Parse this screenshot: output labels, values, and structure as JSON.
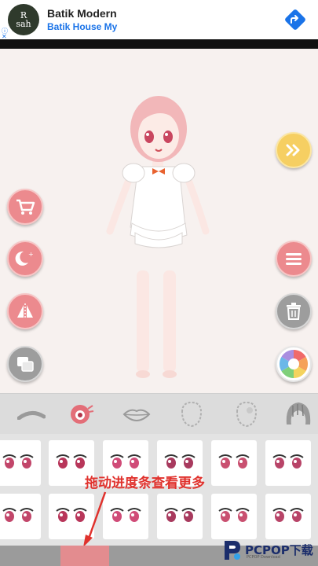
{
  "ad": {
    "logo_text": "R\nsah",
    "title": "Batik Modern",
    "subtitle": "Batik House My",
    "info_icon": "info-icon",
    "close_icon": "close-icon",
    "cta_icon": "directions-arrow-icon"
  },
  "side_buttons": {
    "left": [
      "cart-icon",
      "moon-night-icon",
      "mirror-flip-icon",
      "layers-icon"
    ],
    "right": [
      "fast-forward-icon",
      "menu-icon",
      "trash-icon",
      "color-palette-icon"
    ]
  },
  "categories": [
    "eyebrow-icon",
    "eyes-icon",
    "lips-icon",
    "face-shape-icon",
    "blush-icon",
    "hair-icon"
  ],
  "hint": "拖动进度条查看更多",
  "scroll_progress": 0.19,
  "brand": {
    "name": "PCPOP下载",
    "sub": "PCPOP Download"
  },
  "colors": {
    "accent_pink": "#ec8a8e",
    "hint_red": "#e0322d",
    "brand_blue": "#1b2d6b",
    "ad_blue": "#1a73e8"
  }
}
